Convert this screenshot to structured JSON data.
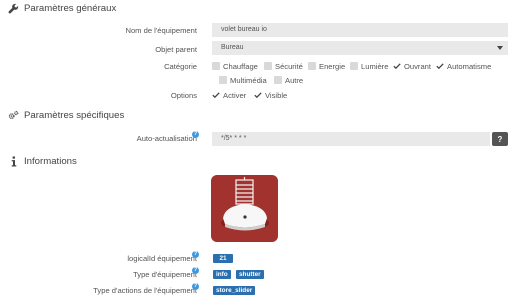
{
  "general": {
    "title": "Paramètres généraux",
    "icon": "wrench-icon",
    "name_label": "Nom de l'équipement",
    "name_value": "volet bureau io",
    "parent_label": "Objet parent",
    "parent_value": "Bureau",
    "category_label": "Catégorie",
    "categories": [
      {
        "label": "Chauffage",
        "checked": false
      },
      {
        "label": "Sécurité",
        "checked": false
      },
      {
        "label": "Energie",
        "checked": false
      },
      {
        "label": "Lumière",
        "checked": false
      },
      {
        "label": "Ouvrant",
        "checked": true
      },
      {
        "label": "Automatisme",
        "checked": true
      },
      {
        "label": "Multimédia",
        "checked": false
      },
      {
        "label": "Autre",
        "checked": false
      }
    ],
    "options_label": "Options",
    "options": [
      {
        "label": "Activer",
        "checked": true
      },
      {
        "label": "Visible",
        "checked": true
      }
    ]
  },
  "specific": {
    "title": "Paramètres spécifiques",
    "icon": "gears-icon",
    "autorefresh_label": "Auto-actualisation",
    "autorefresh_value": "*/5* * * *",
    "cron_help_label": "?"
  },
  "info": {
    "title": "Informations",
    "icon": "info-icon",
    "logical_id_label": "logicalId équipement",
    "logical_id_value": "21",
    "type_label": "Type d'équipement",
    "type_values": [
      "info",
      "shutter"
    ],
    "action_type_label": "Type d'actions de l'équipement",
    "action_type_value": "store_slider",
    "help_glyph": "?"
  },
  "colors": {
    "badge": "#2a6faf",
    "help": "#3c9be0",
    "device_bg": "#a2322d",
    "input_bg": "#e9e9e9"
  }
}
